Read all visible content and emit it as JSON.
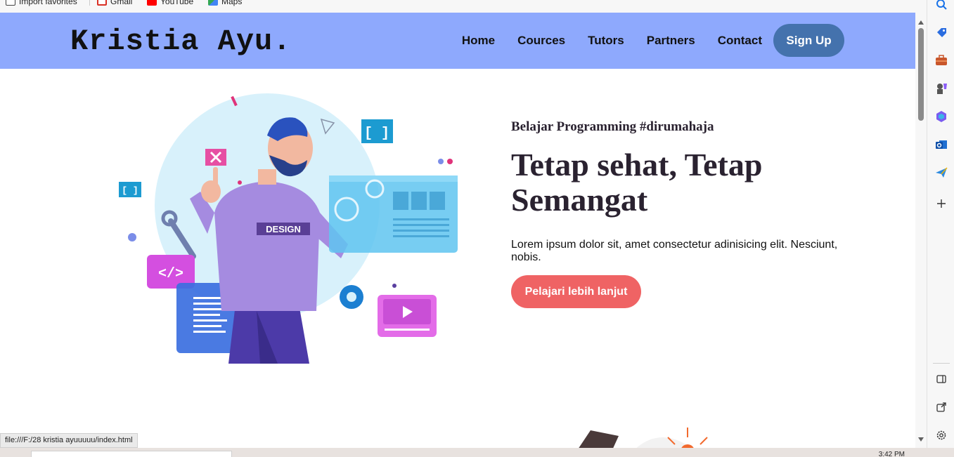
{
  "favorites": [
    {
      "label": "Import favorites",
      "icon": "import-icon"
    },
    {
      "label": "Gmail",
      "icon": "gmail-icon"
    },
    {
      "label": "YouTube",
      "icon": "youtube-icon"
    },
    {
      "label": "Maps",
      "icon": "maps-icon"
    }
  ],
  "site": {
    "brand": "Kristia Ayu.",
    "nav": [
      "Home",
      "Cources",
      "Tutors",
      "Partners",
      "Contact"
    ],
    "signup_label": "Sign Up"
  },
  "hero": {
    "eyebrow": "Belajar Programming #dirumahaja",
    "headline": "Tetap sehat, Tetap Semangat",
    "lead": "Lorem ipsum dolor sit, amet consectetur adinisicing elit. Nesciunt, nobis.",
    "cta_label": "Pelajari lebih lanjut",
    "illustration_badge": "DESIGN"
  },
  "status_url": "file:///F:/28 kristia ayuuuuu/index.html",
  "taskbar": {
    "time": "3:42 PM"
  },
  "colors": {
    "navbar": "#8ea9fd",
    "signup": "#4472ad",
    "cta": "#ef6364",
    "headline": "#2a2230"
  },
  "sidebar_icons": [
    "search-icon",
    "tag-icon",
    "briefcase-icon",
    "chess-icon",
    "copilot-icon",
    "outlook-icon",
    "send-icon",
    "add-icon",
    "split-screen-icon",
    "open-external-icon",
    "settings-icon"
  ]
}
